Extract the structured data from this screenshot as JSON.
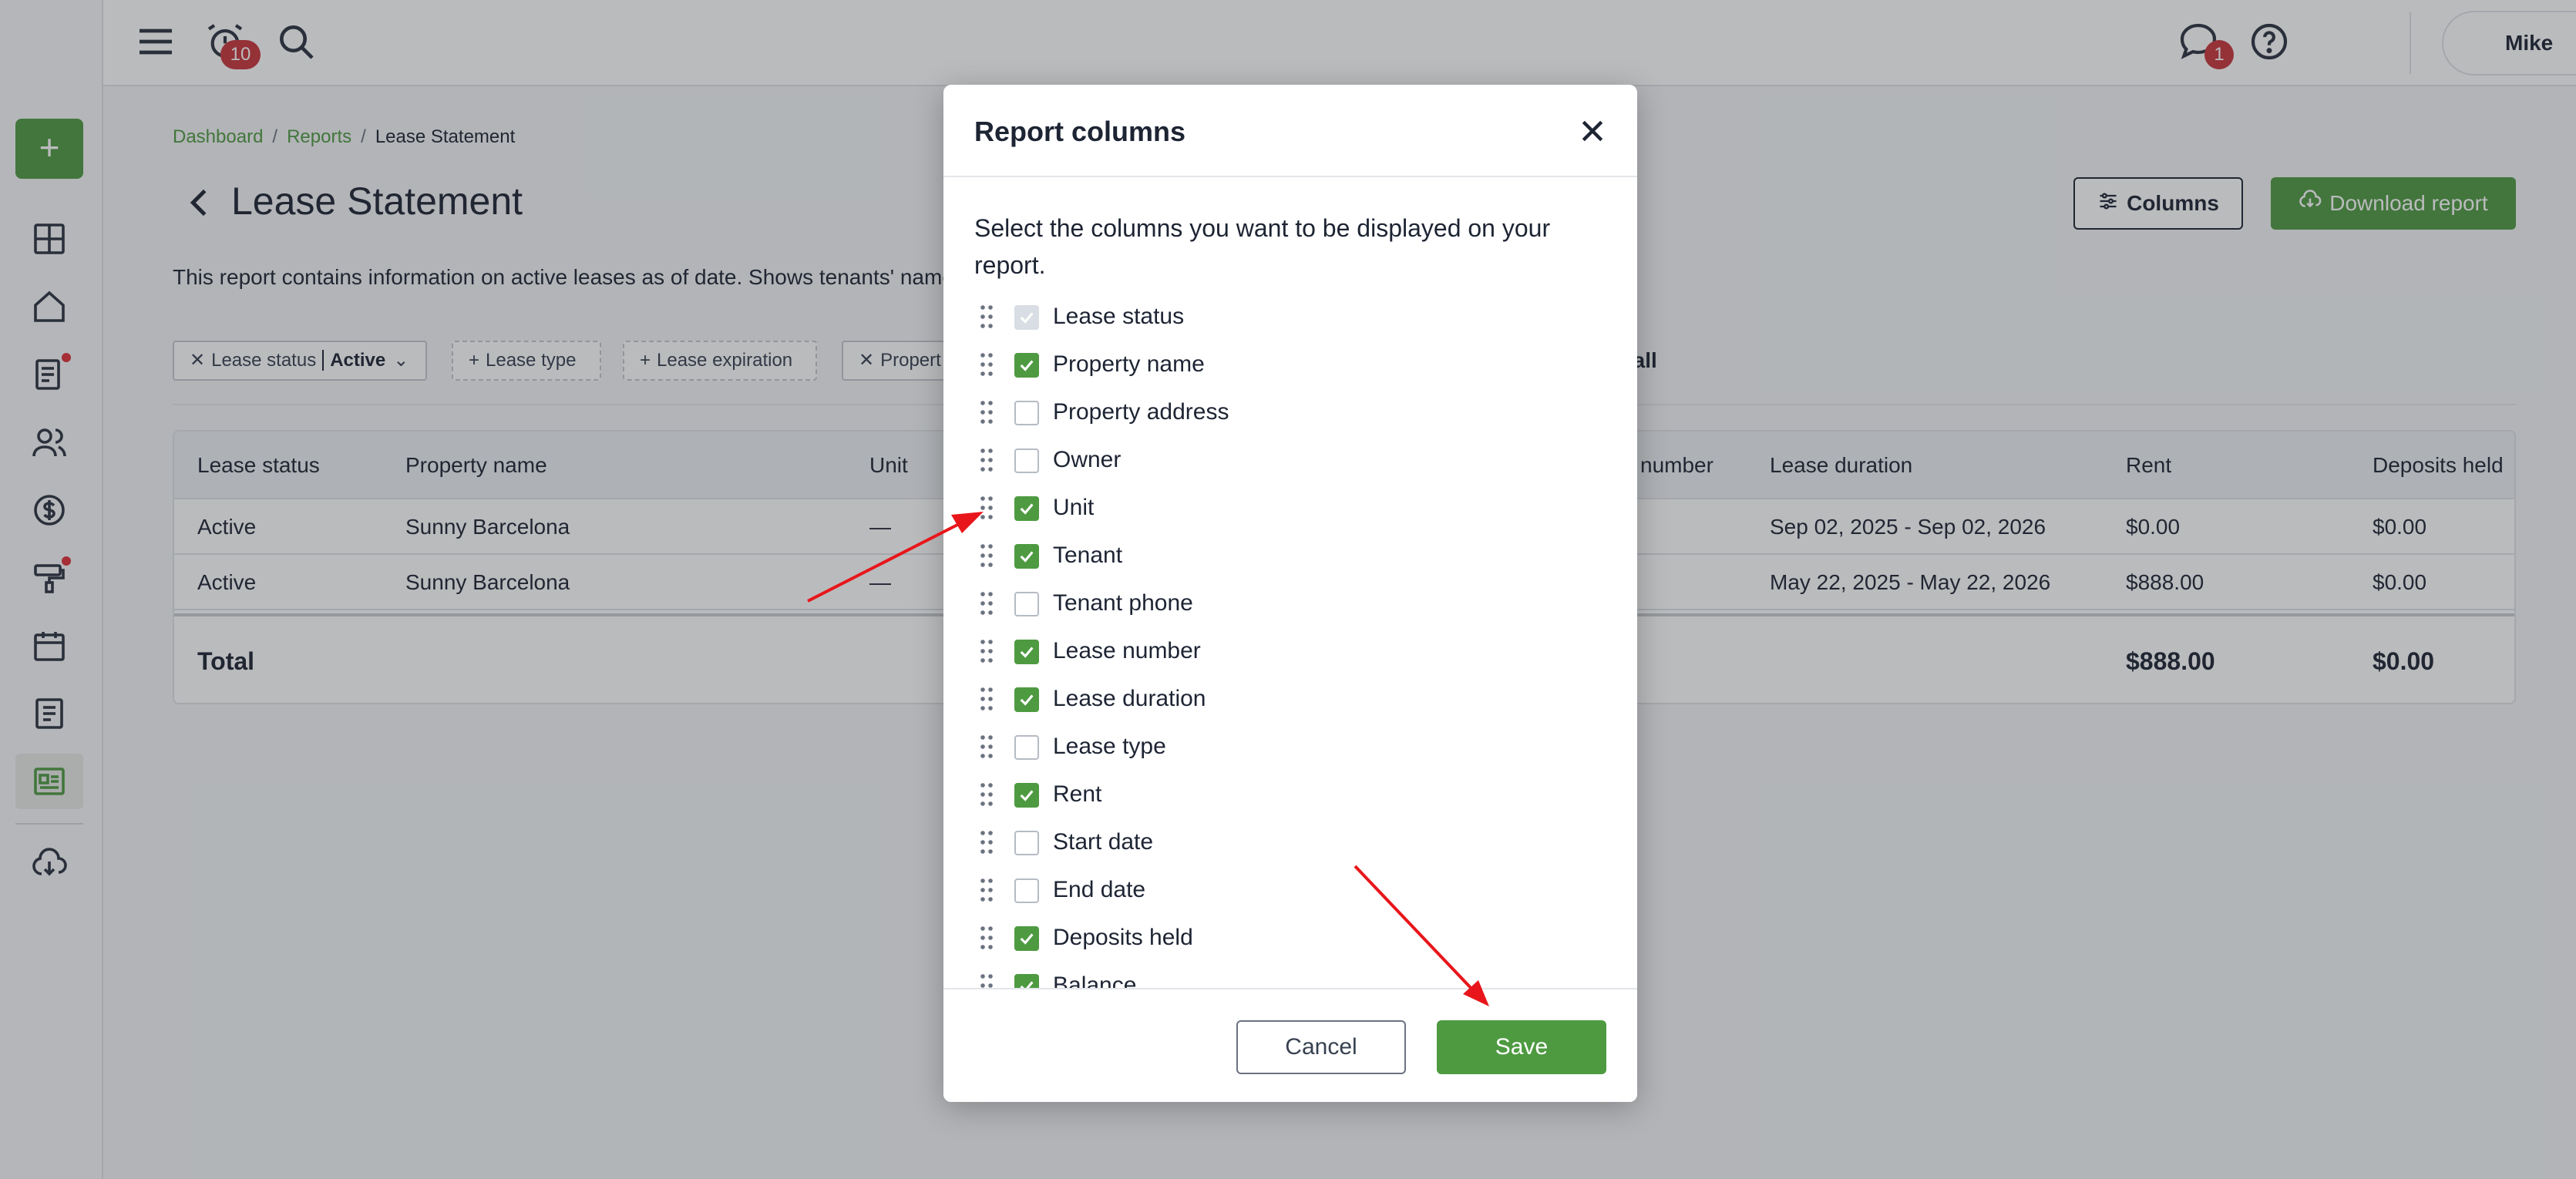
{
  "topbar": {
    "notifications_count": "10",
    "messages_count": "1",
    "user_name": "Mike"
  },
  "breadcrumb": {
    "items": [
      "Dashboard",
      "Reports"
    ],
    "current": "Lease Statement"
  },
  "page": {
    "title": "Lease Statement",
    "description": "This report contains information on active leases as of date. Shows tenants' name,",
    "columns_button": "Columns",
    "download_button": "Download report"
  },
  "filters": {
    "chips": [
      {
        "label": "Lease status",
        "value": "Active"
      },
      {
        "label": "Lease type"
      },
      {
        "label": "Lease expiration"
      },
      {
        "label": "Propert"
      }
    ],
    "clear_all": "r all"
  },
  "table": {
    "headers": [
      "Lease status",
      "Property name",
      "Unit",
      "number",
      "Lease duration",
      "Rent",
      "Deposits held"
    ],
    "rows": [
      [
        "Active",
        "Sunny Barcelona",
        "—",
        "Sep 02, 2025 - Sep 02, 2026",
        "$0.00",
        "$0.00"
      ],
      [
        "Active",
        "Sunny Barcelona",
        "—",
        "May 22, 2025 - May 22, 2026",
        "$888.00",
        "$0.00"
      ]
    ],
    "total_label": "Total",
    "total_rent": "$888.00",
    "total_deposits": "$0.00"
  },
  "modal": {
    "title": "Report columns",
    "instruction": "Select the columns you want to be displayed on your report.",
    "columns": [
      {
        "label": "Lease status",
        "checked": true,
        "disabled": true
      },
      {
        "label": "Property name",
        "checked": true
      },
      {
        "label": "Property address",
        "checked": false
      },
      {
        "label": "Owner",
        "checked": false
      },
      {
        "label": "Unit",
        "checked": true
      },
      {
        "label": "Tenant",
        "checked": true
      },
      {
        "label": "Tenant phone",
        "checked": false
      },
      {
        "label": "Lease number",
        "checked": true
      },
      {
        "label": "Lease duration",
        "checked": true
      },
      {
        "label": "Lease type",
        "checked": false
      },
      {
        "label": "Rent",
        "checked": true
      },
      {
        "label": "Start date",
        "checked": false
      },
      {
        "label": "End date",
        "checked": false
      },
      {
        "label": "Deposits held",
        "checked": true
      },
      {
        "label": "Balance",
        "checked": true
      }
    ],
    "cancel_label": "Cancel",
    "save_label": "Save"
  },
  "colors": {
    "brand_green": "#4e9a41",
    "badge_red": "#c7363b",
    "annotation_red": "#e8161b"
  }
}
